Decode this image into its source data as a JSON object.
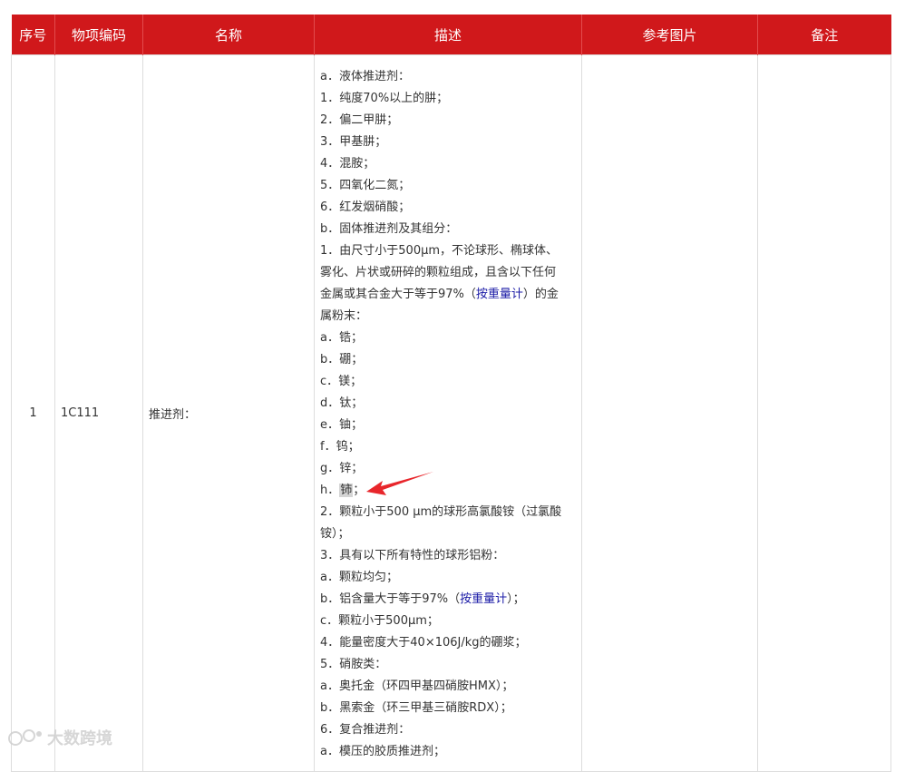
{
  "header": {
    "seq": "序号",
    "code": "物项编码",
    "name": "名称",
    "desc": "描述",
    "image": "参考图片",
    "remark": "备注"
  },
  "row": {
    "seq": "1",
    "code": "1C111",
    "name": "推进剂：",
    "image": "",
    "remark": ""
  },
  "description": {
    "l01": "a．液体推进剂：",
    "l02": "1．纯度70%以上的肼；",
    "l03": "2．偏二甲肼；",
    "l04": "3．甲基肼；",
    "l05": "4．混胺；",
    "l06": "5．四氧化二氮；",
    "l07": "6．红发烟硝酸；",
    "l08": "b．固体推进剂及其组分：",
    "l09": "1．由尺寸小于500μm，不论球形、椭球体、",
    "l10": "雾化、片状或研碎的颗粒组成，且含以下任何",
    "l11a": "金属或其合金大于等于97%（",
    "l11_link": "按重量计",
    "l11b": "）的金",
    "l12": "属粉末：",
    "l13": "a．锆；",
    "l14": "b．硼；",
    "l15": "c．镁；",
    "l16": "d．钛；",
    "l17": "e．铀；",
    "l18": "f．钨；",
    "l19": "g．锌；",
    "l20a": "h．",
    "l20_hl": "铈",
    "l20b": "；",
    "l21": "2．颗粒小于500 μm的球形高氯酸铵（过氯酸",
    "l22": "铵）；",
    "l23": "3．具有以下所有特性的球形铝粉：",
    "l24": "a．颗粒均匀；",
    "l25a": "b．铝含量大于等于97%（",
    "l25_link": "按重量计",
    "l25b": "）；",
    "l26": "c．颗粒小于500μm；",
    "l27": "4．能量密度大于40×106J/kg的硼浆；",
    "l28": "5．硝胺类：",
    "l29": "a．奥托金（环四甲基四硝胺HMX）；",
    "l30": "b．黑索金（环三甲基三硝胺RDX）；",
    "l31": "6．复合推进剂：",
    "l32": "a．模压的胶质推进剂；"
  },
  "watermark": {
    "text": "大数跨境"
  },
  "colors": {
    "header_bg": "#d0181b",
    "link": "#1a1aa6",
    "arrow": "#e8262b"
  }
}
